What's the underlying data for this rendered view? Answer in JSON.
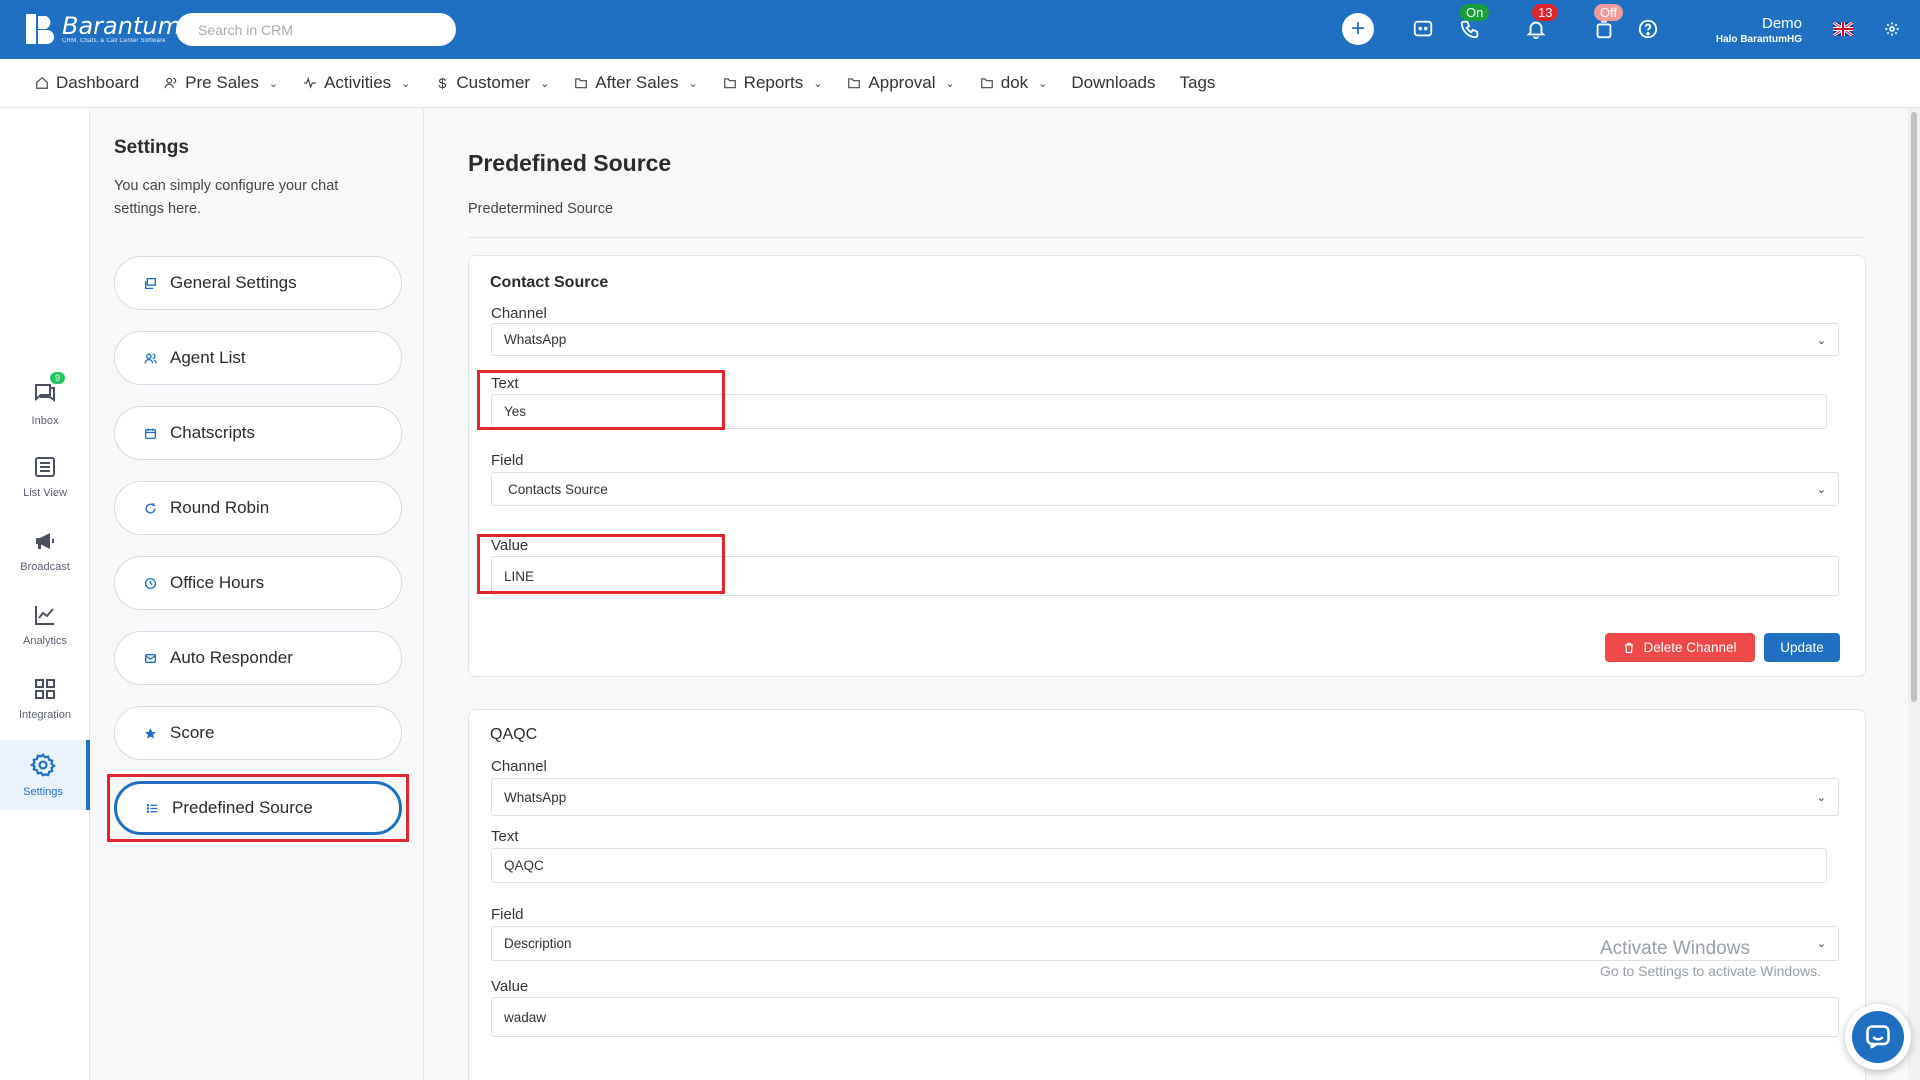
{
  "brand": {
    "name": "Barantum",
    "tagline": "CRM, Chats, & Call Center Software"
  },
  "search": {
    "placeholder": "Search in CRM"
  },
  "topbar": {
    "phone_status": "On",
    "notifications_count": "13",
    "agent_status": "Off",
    "user_name": "Demo",
    "user_role": "Halo BarantumHG"
  },
  "nav": {
    "items": [
      {
        "label": "Dashboard",
        "icon": "home-icon",
        "dropdown": false
      },
      {
        "label": "Pre Sales",
        "icon": "users-icon",
        "dropdown": true
      },
      {
        "label": "Activities",
        "icon": "activity-icon",
        "dropdown": true
      },
      {
        "label": "Customer",
        "icon": "dollar-icon",
        "dropdown": true
      },
      {
        "label": "After Sales",
        "icon": "folder-icon",
        "dropdown": true
      },
      {
        "label": "Reports",
        "icon": "folder-icon",
        "dropdown": true
      },
      {
        "label": "Approval",
        "icon": "folder-icon",
        "dropdown": true
      },
      {
        "label": "dok",
        "icon": "folder-icon",
        "dropdown": true
      },
      {
        "label": "Downloads",
        "icon": "",
        "dropdown": false
      },
      {
        "label": "Tags",
        "icon": "",
        "dropdown": false
      }
    ]
  },
  "rail": {
    "items": [
      {
        "label": "Inbox",
        "icon": "chat-icon",
        "badge": "9"
      },
      {
        "label": "List View",
        "icon": "list-icon"
      },
      {
        "label": "Broadcast",
        "icon": "megaphone-icon"
      },
      {
        "label": "Analytics",
        "icon": "chart-icon"
      },
      {
        "label": "Integration",
        "icon": "grid-icon"
      },
      {
        "label": "Settings",
        "icon": "gear-icon",
        "active": true
      }
    ]
  },
  "settings": {
    "title": "Settings",
    "description": "You can simply configure your chat settings here.",
    "items": [
      {
        "label": "General Settings",
        "icon": "window-icon"
      },
      {
        "label": "Agent List",
        "icon": "users-icon"
      },
      {
        "label": "Chatscripts",
        "icon": "calendar-icon"
      },
      {
        "label": "Round Robin",
        "icon": "refresh-icon"
      },
      {
        "label": "Office Hours",
        "icon": "clock-icon"
      },
      {
        "label": "Auto Responder",
        "icon": "mail-icon"
      },
      {
        "label": "Score",
        "icon": "star-icon"
      },
      {
        "label": "Predefined Source",
        "icon": "list-icon",
        "active": true
      }
    ]
  },
  "page": {
    "title": "Predefined Source",
    "subtitle": "Predetermined Source"
  },
  "cards": [
    {
      "title": "Contact Source",
      "channel_label": "Channel",
      "channel_value": "WhatsApp",
      "text_label": "Text",
      "text_value": "Yes",
      "field_label": "Field",
      "field_value": "Contacts Source",
      "value_label": "Value",
      "value_value": "LINE",
      "delete_label": "Delete Channel",
      "update_label": "Update"
    },
    {
      "title": "QAQC",
      "channel_label": "Channel",
      "channel_value": "WhatsApp",
      "text_label": "Text",
      "text_value": "QAQC",
      "field_label": "Field",
      "field_value": "Description",
      "value_label": "Value",
      "value_value": "wadaw"
    }
  ],
  "watermark": {
    "title": "Activate Windows",
    "subtitle": "Go to Settings to activate Windows."
  },
  "colors": {
    "primary": "#1f6fc2",
    "danger": "#ee4848",
    "highlight": "#e0262b",
    "online": "#1a9e3a"
  }
}
